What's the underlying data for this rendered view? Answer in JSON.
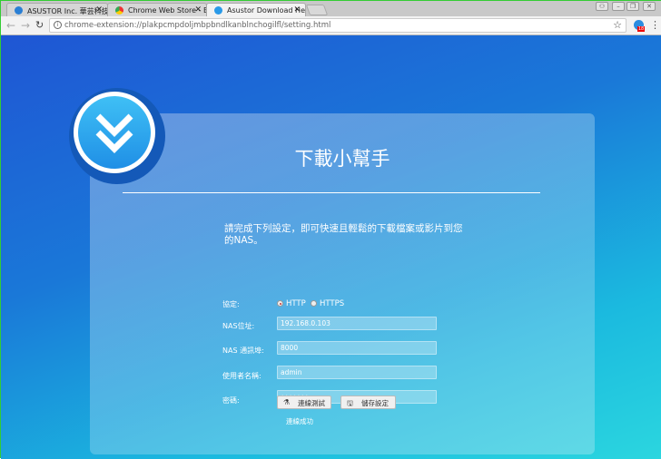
{
  "browser": {
    "tabs": [
      {
        "label": "ASUSTOR Inc. 華芸科技",
        "active": false
      },
      {
        "label": "Chrome Web Store - Ex",
        "active": false
      },
      {
        "label": "Asustor Download Help",
        "active": true
      }
    ],
    "url": "chrome-extension://plakpcmpdoljmbpbndlkanblnchogilfl/setting.html",
    "extension_badge": "18"
  },
  "app": {
    "title": "下載小幫手",
    "description": "請完成下列設定，即可快速且輕鬆的下載檔案或影片到您的NAS。",
    "protocol_label": "協定:",
    "protocol_options": [
      "HTTP",
      "HTTPS"
    ],
    "protocol_selected": "HTTP",
    "address_label": "NAS位址:",
    "address_value": "192.168.0.103",
    "port_label": "NAS 通訊埠:",
    "port_value": "8000",
    "username_label": "使用者名稱:",
    "username_value": "admin",
    "password_label": "密碼:",
    "password_value": "•••••••",
    "test_button": "連線測試",
    "save_button": "儲存設定",
    "status": "連線成功"
  }
}
